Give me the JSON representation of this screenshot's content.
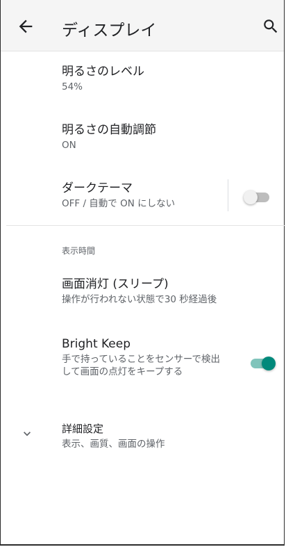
{
  "appbar": {
    "title": "ディスプレイ",
    "back_icon": "arrow-back-icon",
    "search_icon": "search-icon"
  },
  "items": {
    "brightness": {
      "title": "明るさのレベル",
      "summary": "54%"
    },
    "auto_brightness": {
      "title": "明るさの自動調節",
      "summary": "ON"
    },
    "dark_theme": {
      "title": "ダークテーマ",
      "summary": "OFF / 自動で ON にしない",
      "enabled": false
    },
    "sleep": {
      "title": "画面消灯 (スリープ)",
      "summary": "操作が行われない状態で30 秒経過後"
    },
    "bright_keep": {
      "title": "Bright Keep",
      "summary": "手で持っていることをセンサーで検出して画面の点灯をキープする",
      "enabled": true
    },
    "advanced": {
      "title": "詳細設定",
      "summary": "表示、画質、画面の操作"
    }
  },
  "sections": {
    "display_time": "表示時間"
  },
  "colors": {
    "accent": "#00897b",
    "accent_track": "#80c4bb",
    "off_thumb": "#f1f1f1",
    "off_track": "#bdbdbd"
  }
}
